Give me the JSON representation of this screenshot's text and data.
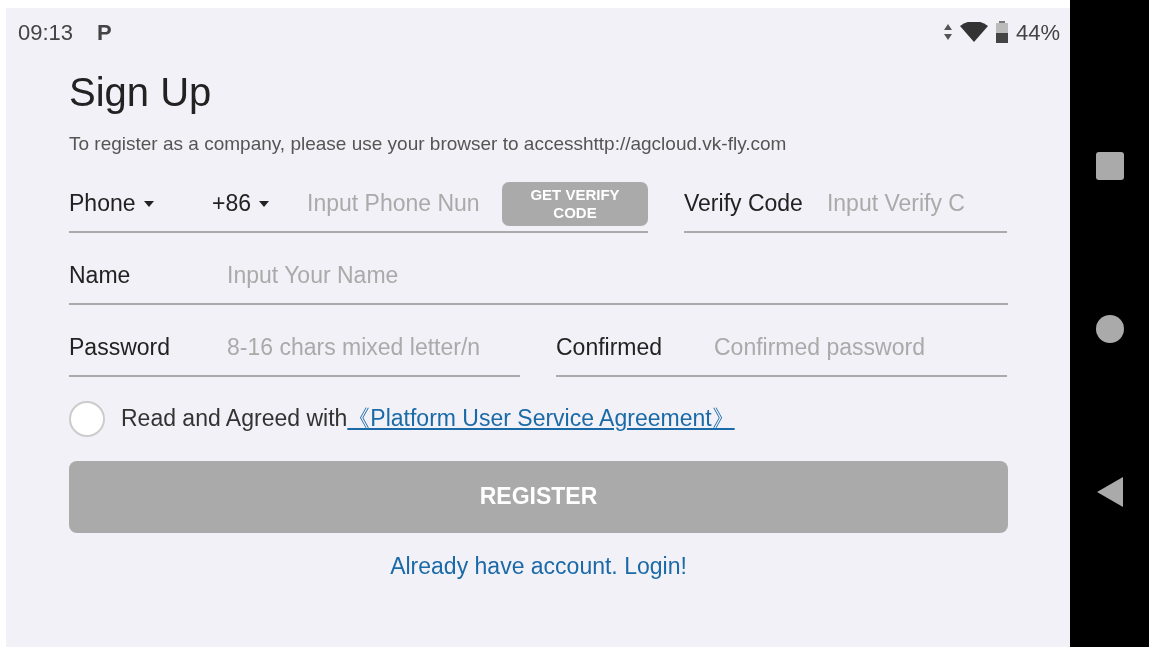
{
  "status_bar": {
    "time": "09:13",
    "app_letter": "P",
    "battery": "44%"
  },
  "title": "Sign Up",
  "notice": "To register as a company, please use your browser to accesshttp://agcloud.vk-fly.com",
  "phone_row": {
    "type_label": "Phone",
    "country_code": "+86",
    "phone_placeholder": "Input Phone Nun",
    "verify_button": "GET VERIFY CODE",
    "verify_label": "Verify Code",
    "verify_placeholder": "Input Verify C"
  },
  "name_row": {
    "label": "Name",
    "placeholder": "Input Your Name"
  },
  "password_row": {
    "label": "Password",
    "placeholder": "8-16 chars mixed letter/n",
    "confirm_label": "Confirmed",
    "confirm_placeholder": "Confirmed password"
  },
  "agreement": {
    "checked": false,
    "text": "Read and Agreed with",
    "link": "《Platform User Service Agreement》"
  },
  "register_button": {
    "label": "REGISTER",
    "disabled": true
  },
  "login_link": "Already have account. Login!"
}
